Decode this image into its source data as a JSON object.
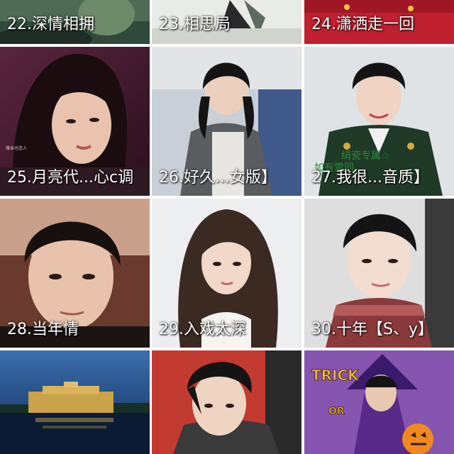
{
  "gallery": {
    "tiles": [
      {
        "caption": "22.深情相拥"
      },
      {
        "caption": "23.相思局"
      },
      {
        "caption": "24.潇洒走一回"
      },
      {
        "caption": "25.月亮代...心c调"
      },
      {
        "caption": "26.好久...女版】"
      },
      {
        "caption": "27.我很...音质】"
      },
      {
        "caption": "28.当年情"
      },
      {
        "caption": "29.入戏太深"
      },
      {
        "caption": "30.十年【S、y】"
      },
      {
        "caption": ""
      },
      {
        "caption": ""
      },
      {
        "caption": ""
      }
    ],
    "overlays": {
      "tile27_text1": "绢瓷专属☆",
      "tile27_text2": "如有雷同",
      "tile25_small": "雅米也恋人",
      "trick_word": "TRICK",
      "or_word": "OR"
    }
  },
  "colors": {
    "caption_text": "#ffffff",
    "grid_gap": "#ffffff"
  }
}
